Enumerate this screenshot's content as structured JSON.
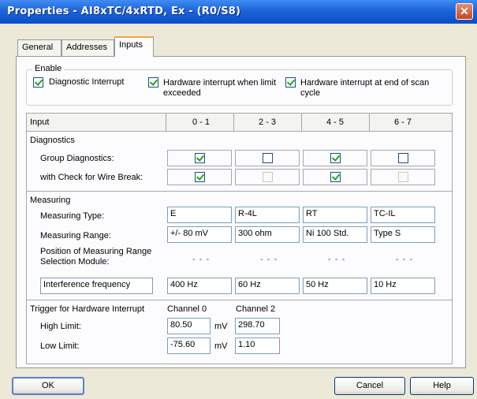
{
  "window": {
    "title": "Properties - AI8xTC/4xRTD, Ex - (R0/S8)",
    "close_glyph": "✕"
  },
  "tabs": [
    {
      "label": "General"
    },
    {
      "label": "Addresses"
    },
    {
      "label": "Inputs",
      "active": true
    }
  ],
  "enable": {
    "caption": "Enable",
    "items": [
      {
        "label": "Diagnostic Interrupt",
        "checked": true
      },
      {
        "label": "Hardware interrupt when limit exceeded",
        "checked": true
      },
      {
        "label": "Hardware interrupt at end of scan cycle",
        "checked": true
      }
    ]
  },
  "grid": {
    "header_label": "Input",
    "columns": [
      "0 - 1",
      "2 - 3",
      "4 - 5",
      "6 - 7"
    ],
    "diagnostics": {
      "caption": "Diagnostics",
      "group_label": "Group Diagnostics:",
      "group_checks": [
        true,
        false,
        true,
        false
      ],
      "wire_label": "with Check for Wire Break:",
      "wire_checks": [
        true,
        false,
        true,
        false
      ],
      "wire_enabled": [
        true,
        false,
        true,
        false
      ]
    },
    "measuring": {
      "caption": "Measuring",
      "type_label": "Measuring Type:",
      "types": [
        "E",
        "R-4L",
        "RT",
        "TC-IL"
      ],
      "range_label": "Measuring Range:",
      "ranges": [
        "+/- 80 mV",
        "300 ohm",
        "Ni 100 Std.",
        "Type S"
      ],
      "position_label": "Position of Measuring Range Selection Module:",
      "positions": [
        "- - -",
        "- - -",
        "- - -",
        "- - -"
      ],
      "interference_label": "Interference frequency",
      "interference": [
        "400 Hz",
        "60 Hz",
        "50 Hz",
        "10 Hz"
      ]
    },
    "trigger": {
      "caption": "Trigger for Hardware Interrupt",
      "channel_a": "Channel 0",
      "channel_b": "Channel 2",
      "high_label": "High Limit:",
      "high_a": "80.50",
      "high_b": "298.70",
      "low_label": "Low Limit:",
      "low_a": "-75.60",
      "low_b": "1.10",
      "unit": "mV"
    }
  },
  "buttons": {
    "ok": "OK",
    "cancel": "Cancel",
    "help": "Help"
  }
}
